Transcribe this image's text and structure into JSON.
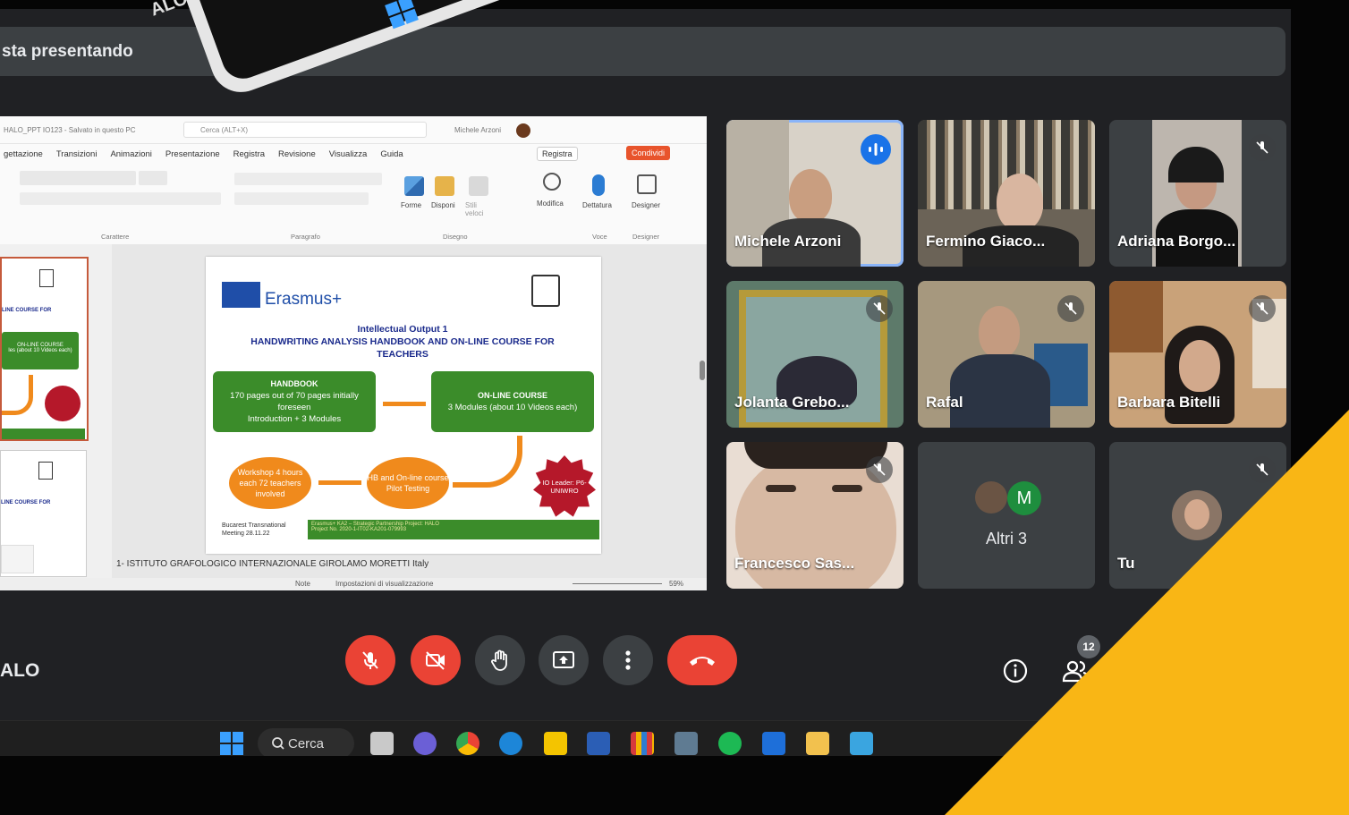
{
  "banner": {
    "text": "sta presentando"
  },
  "phone": {
    "text": "ALO"
  },
  "ppt": {
    "doc_title": "HALO_PPT IO123 - Salvato in questo PC",
    "search_placeholder": "Cerca (ALT+X)",
    "user": "Michele Arzoni",
    "tabs": [
      "gettazione",
      "Transizioni",
      "Animazioni",
      "Presentazione",
      "Registra",
      "Revisione",
      "Visualizza",
      "Guida"
    ],
    "record_label": "Registra",
    "share_label": "Condividi",
    "ribbon_groups": [
      "Carattere",
      "Paragrafo",
      "Disegno",
      "Voce",
      "Designer"
    ],
    "ribbon_buttons": [
      "Forme",
      "Disponi",
      "Stili veloci",
      "Modifica",
      "Dettatura",
      "Designer"
    ],
    "slide": {
      "brand": "Erasmus+",
      "heading_line1": "Intellectual Output 1",
      "heading_line2": "HANDWRITING ANALYSIS HANDBOOK AND ON-LINE COURSE FOR TEACHERS",
      "handbook_title": "HANDBOOK",
      "handbook_text": "170 pages out of 70 pages initially foreseen",
      "handbook_modules": "Introduction + 3 Modules",
      "online_title": "ON-LINE COURSE",
      "online_text": "3 Modules (about 10 Videos each)",
      "workshop": "Workshop 4 hours each 72 teachers involved",
      "pilot": "HB and On-line course Pilot Testing",
      "seal": "IO Leader: P6-UNIWRO",
      "meeting": "Bucarest Transnational Meeting 28.11.22",
      "project_line1": "Erasmus+ KA2 – Strategic Partnership Project: HALO",
      "project_line2": "Project No. 2020-1-IT02-KA201-079993"
    },
    "thumb_line1": "LINE COURSE FOR",
    "thumb_line2": "ON-LINE COURSE",
    "thumb_line3": "les (about 10 Videos each)",
    "notes": "1- ISTITUTO GRAFOLOGICO INTERNAZIONALE GIROLAMO MORETTI Italy",
    "status_notes": "Note",
    "status_view": "Impostazioni di visualizzazione",
    "zoom": "59%"
  },
  "participants": [
    {
      "name": "Michele Arzoni",
      "speaking": true
    },
    {
      "name": "Fermino Giaco...",
      "muted": false
    },
    {
      "name": "Adriana Borgo...",
      "muted": true
    },
    {
      "name": "Jolanta Grebo...",
      "muted": true
    },
    {
      "name": "Rafal",
      "muted": true
    },
    {
      "name": "Barbara Bitelli",
      "muted": true
    },
    {
      "name": "Francesco Sas...",
      "muted": true
    },
    {
      "name": "Altri 3",
      "avatar_letter": "M"
    },
    {
      "name": "Tu",
      "muted": true
    }
  ],
  "meeting": {
    "name": "ALO",
    "people_count": "12"
  },
  "taskbar": {
    "search_label": "Cerca"
  },
  "colors": {
    "accent": "#F9B615",
    "end_call": "#EA4335",
    "speaking": "#1A73E8"
  }
}
